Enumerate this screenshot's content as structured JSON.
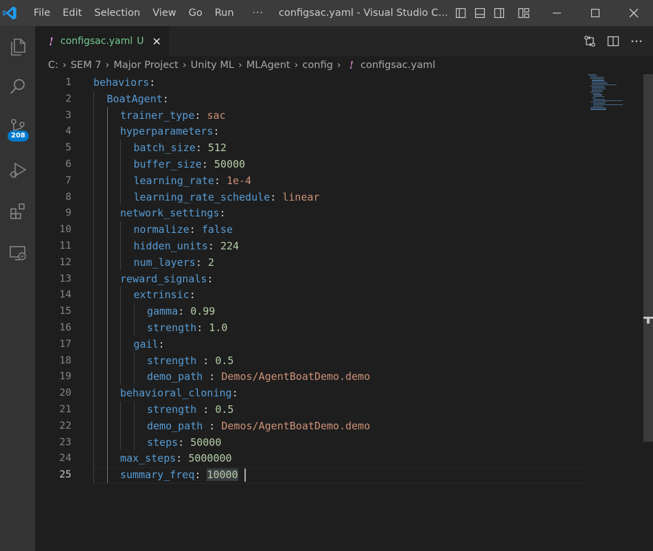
{
  "titlebar": {
    "menu": [
      "File",
      "Edit",
      "Selection",
      "View",
      "Go",
      "Run"
    ],
    "more": "···",
    "title": "configsac.yaml - Visual Studio Code..."
  },
  "activity": {
    "scm_badge": "208"
  },
  "tab": {
    "excl": "!",
    "name": "configsac.yaml",
    "status": "U",
    "close": "✕"
  },
  "breadcrumb": {
    "parts": [
      "C:",
      "SEM 7",
      "Major Project",
      "Unity ML",
      "MLAgent",
      "config"
    ],
    "file_excl": "!",
    "file": "configsac.yaml"
  },
  "editor": {
    "line_numbers": [
      "1",
      "2",
      "3",
      "4",
      "5",
      "6",
      "7",
      "8",
      "9",
      "10",
      "11",
      "12",
      "13",
      "14",
      "15",
      "16",
      "17",
      "18",
      "19",
      "20",
      "21",
      "22",
      "23",
      "24",
      "25"
    ],
    "lines": [
      {
        "key": "behaviors",
        "sep": ":",
        "value": "",
        "vtype": ""
      },
      {
        "key": "BoatAgent",
        "sep": ":",
        "value": "",
        "vtype": ""
      },
      {
        "key": "trainer_type",
        "sep": ": ",
        "value": "sac",
        "vtype": "s"
      },
      {
        "key": "hyperparameters",
        "sep": ":",
        "value": "",
        "vtype": ""
      },
      {
        "key": "batch_size",
        "sep": ": ",
        "value": "512",
        "vtype": "n"
      },
      {
        "key": "buffer_size",
        "sep": ": ",
        "value": "50000",
        "vtype": "n"
      },
      {
        "key": "learning_rate",
        "sep": ": ",
        "value": "1e-4",
        "vtype": "s"
      },
      {
        "key": "learning_rate_schedule",
        "sep": ": ",
        "value": "linear",
        "vtype": "s"
      },
      {
        "key": "network_settings",
        "sep": ":",
        "value": "",
        "vtype": ""
      },
      {
        "key": "normalize",
        "sep": ": ",
        "value": "false",
        "vtype": "b"
      },
      {
        "key": "hidden_units",
        "sep": ": ",
        "value": "224",
        "vtype": "n"
      },
      {
        "key": "num_layers",
        "sep": ": ",
        "value": "2",
        "vtype": "n"
      },
      {
        "key": "reward_signals",
        "sep": ":",
        "value": "",
        "vtype": ""
      },
      {
        "key": "extrinsic",
        "sep": ":",
        "value": "",
        "vtype": ""
      },
      {
        "key": "gamma",
        "sep": ": ",
        "value": "0.99",
        "vtype": "n"
      },
      {
        "key": "strength",
        "sep": ": ",
        "value": "1.0",
        "vtype": "n"
      },
      {
        "key": "gail",
        "sep": ":",
        "value": "",
        "vtype": ""
      },
      {
        "key": "strength",
        "sep": " : ",
        "value": "0.5",
        "vtype": "n"
      },
      {
        "key": "demo_path",
        "sep": " : ",
        "value": "Demos/AgentBoatDemo.demo",
        "vtype": "s"
      },
      {
        "key": "behavioral_cloning",
        "sep": ":",
        "value": "",
        "vtype": ""
      },
      {
        "key": "strength",
        "sep": " : ",
        "value": "0.5",
        "vtype": "n"
      },
      {
        "key": "demo_path",
        "sep": " : ",
        "value": "Demos/AgentBoatDemo.demo",
        "vtype": "s"
      },
      {
        "key": "steps",
        "sep": ": ",
        "value": "50000",
        "vtype": "n"
      },
      {
        "key": "max_steps",
        "sep": ": ",
        "value": "5000000",
        "vtype": "n"
      },
      {
        "key": "summary_freq",
        "sep": ": ",
        "value": "10000",
        "vtype": "n"
      }
    ],
    "active_line": "25"
  },
  "colors": {
    "key": "#569cd6",
    "string": "#ce9178",
    "number": "#b5cea8",
    "accent": "#007acc",
    "untracked": "#73c991",
    "yaml_icon": "#c586c0"
  },
  "icons": [
    "vscode-logo-icon",
    "layout-sidebar-left-icon",
    "layout-panel-icon",
    "layout-sidebar-right-icon",
    "customize-layout-icon",
    "minimize-icon",
    "maximize-icon",
    "close-window-icon",
    "explorer-icon",
    "search-icon",
    "source-control-icon",
    "run-debug-icon",
    "extensions-icon",
    "remote-explorer-icon",
    "compare-changes-icon",
    "split-editor-icon",
    "more-actions-icon"
  ]
}
